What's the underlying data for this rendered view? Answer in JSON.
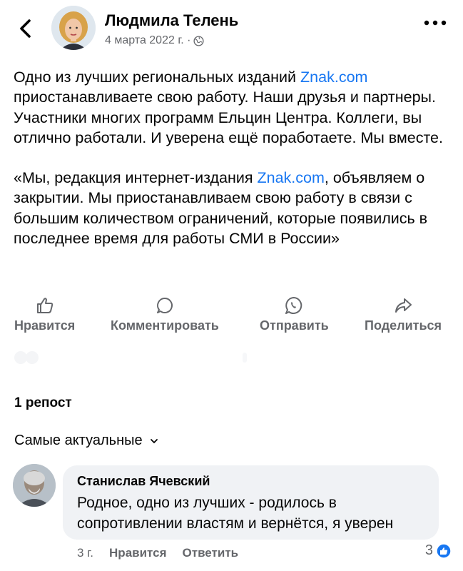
{
  "header": {
    "author_name": "Людмила Телень",
    "post_date": "4 марта 2022 г. ·"
  },
  "post": {
    "para1_a": "Одно из лучших региональных изданий ",
    "para1_link": "Znak.com",
    "para1_b": " приостанавливаете свою работу. Наши друзья и партнеры. Участники многих программ Ельцин Центра. Коллеги, вы отлично работали. И уверена ещё поработаете. Мы вместе.",
    "para2_a": "«Мы, редакция интернет-издания ",
    "para2_link": "Znak.com",
    "para2_b": ", объявляем о закрытии. Мы приостанавливаем свою работу в связи с большим количеством ограничений, которые появились в последнее время для работы СМИ в России»"
  },
  "actions": {
    "like": "Нравится",
    "comment": "Комментировать",
    "send": "Отправить",
    "share": "Поделиться"
  },
  "reposts": "1 репост",
  "sort_label": "Самые актуальные",
  "comment": {
    "author": "Станислав Ячевский",
    "text": "Родное, одно из лучших - родилось в сопротивлении властям и вернётся, я уверен",
    "time": "3 г.",
    "like_label": "Нравится",
    "reply_label": "Ответить",
    "likes_count": "3"
  },
  "colors": {
    "link": "#1877f2",
    "secondary_text": "#65676b",
    "bubble": "#f0f2f5"
  }
}
